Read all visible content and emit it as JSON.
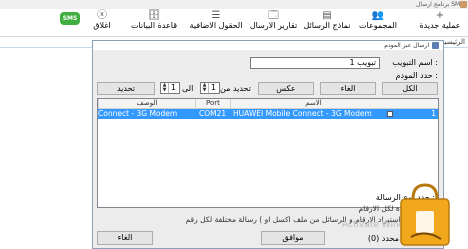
{
  "window": {
    "title": "برنامج ارسال SMS"
  },
  "ribbon": {
    "items": [
      {
        "label": "عملية جديدة",
        "icon": "plus-icon"
      },
      {
        "label": "المجموعات",
        "icon": "people-icon"
      },
      {
        "label": "نماذج الرسائل",
        "icon": "template-icon"
      },
      {
        "label": "تقارير الارسال",
        "icon": "report-icon"
      },
      {
        "label": "الحقول الاضافية",
        "icon": "fields-icon"
      },
      {
        "label": "قاعدة البيانات",
        "icon": "database-icon"
      },
      {
        "label": "اغلاق",
        "icon": "close-circle-icon"
      }
    ],
    "sms_logo": "SMS"
  },
  "tabs": {
    "home": "الرئيسية"
  },
  "dialog": {
    "title": "ارسال عبر المودم",
    "tab_name_label": "اسم التبويب :",
    "tab_name_value": "تبويب 1",
    "select_modem_label": "حدد المودم :",
    "buttons": {
      "all": "الكل",
      "cancel_select": "الغاء",
      "invert": "عكس",
      "select_range": "تحديد",
      "ok": "موافق",
      "cancel": "الغاء"
    },
    "range": {
      "from_label": "تحديد من",
      "from_value": "1",
      "to_label": "الى",
      "to_value": "1"
    },
    "grid": {
      "columns": [
        "الاسم",
        "Port",
        "الوصف"
      ],
      "rows": [
        {
          "num": "1",
          "name": "HUAWEI Mobile Connect - 3G Modem",
          "port": "COM21",
          "desc": "Connect - 3G Modem"
        }
      ]
    },
    "message_type_label": "حدد نوع الرسالة :",
    "options": [
      "رسالة واحدة لكل الارقام",
      "رسالة مختلفة لكل رقم ( يتم استيراد الارقام و الرسائل من ملف اكسل او CSV )"
    ],
    "selected_count_label": "(0) محدد"
  },
  "watermark": "Activate Windo"
}
